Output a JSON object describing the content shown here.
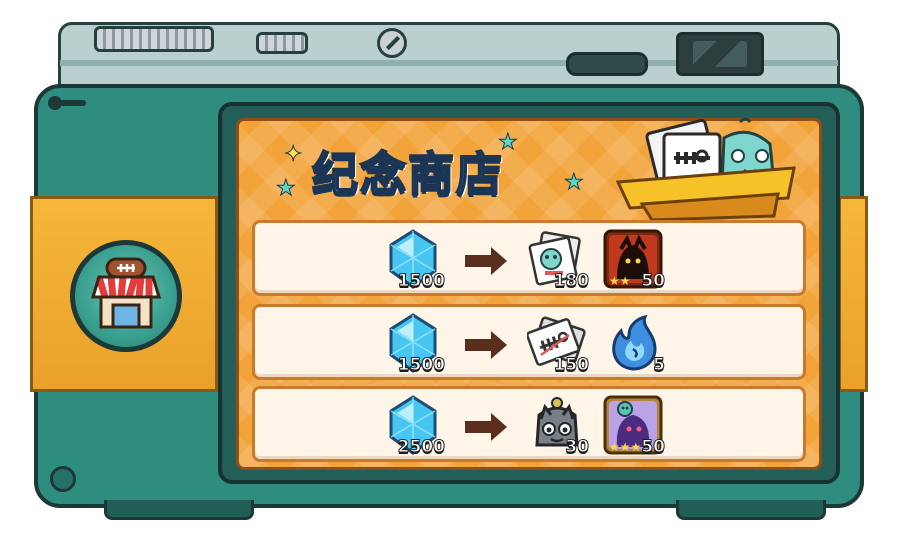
{
  "shop": {
    "title": "纪念商店",
    "rows": [
      {
        "cost": {
          "icon": "blue-diamond-icon",
          "amount": "1500"
        },
        "rewards": [
          {
            "icon": "photo-card-icon",
            "amount": "180"
          },
          {
            "icon": "dark-hero-shard-icon",
            "amount": "50",
            "stars": 2
          }
        ]
      },
      {
        "cost": {
          "icon": "blue-diamond-icon",
          "amount": "1500"
        },
        "rewards": [
          {
            "icon": "fish-bone-card-icon",
            "amount": "150"
          },
          {
            "icon": "blue-spirit-flame-icon",
            "amount": "5"
          }
        ]
      },
      {
        "cost": {
          "icon": "blue-diamond-icon",
          "amount": "2500"
        },
        "rewards": [
          {
            "icon": "cat-bell-icon",
            "amount": "30"
          },
          {
            "icon": "skull-hero-shard-icon",
            "amount": "50",
            "stars": 3
          }
        ]
      }
    ]
  },
  "colors": {
    "camera_teal": "#2f8d80",
    "strap_orange": "#f6b73a",
    "screen_orange": "#f2a33a",
    "row_cream": "#fff5e8",
    "title_blue": "#3ec6f2",
    "arrow_brown": "#5a2e1c"
  }
}
